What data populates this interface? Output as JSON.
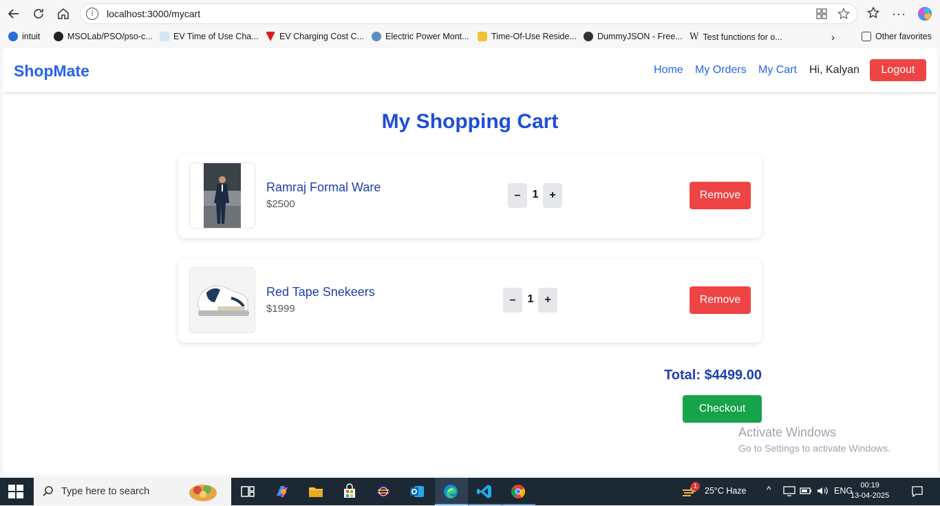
{
  "browser": {
    "url": "localhost:3000/mycart",
    "bookmarks": [
      "intuit",
      "MSOLab/PSO/pso-c...",
      "EV Time of Use Cha...",
      "EV Charging Cost C...",
      "Electric Power Mont...",
      "Time-Of-Use Reside...",
      "DummyJSON - Free...",
      "Test functions for o..."
    ],
    "other_favorites": "Other favorites"
  },
  "app": {
    "brand": "ShopMate",
    "nav": {
      "home": "Home",
      "orders": "My Orders",
      "cart": "My Cart",
      "greeting": "Hi, Kalyan",
      "logout": "Logout"
    },
    "title": "My Shopping Cart",
    "items": [
      {
        "name": "Ramraj Formal Ware",
        "price": "$2500",
        "qty": "1",
        "remove": "Remove",
        "minus": "–",
        "plus": "+"
      },
      {
        "name": "Red Tape Snekeers",
        "price": "$1999",
        "qty": "1",
        "remove": "Remove",
        "minus": "–",
        "plus": "+"
      }
    ],
    "total": "Total: $4499.00",
    "checkout": "Checkout"
  },
  "watermark": {
    "line1": "Activate Windows",
    "line2": "Go to Settings to activate Windows."
  },
  "taskbar": {
    "search_placeholder": "Type here to search",
    "weather": "25°C  Haze",
    "weather_badge": "1",
    "lang": "ENG",
    "time": "00:19",
    "date": "13-04-2025"
  }
}
